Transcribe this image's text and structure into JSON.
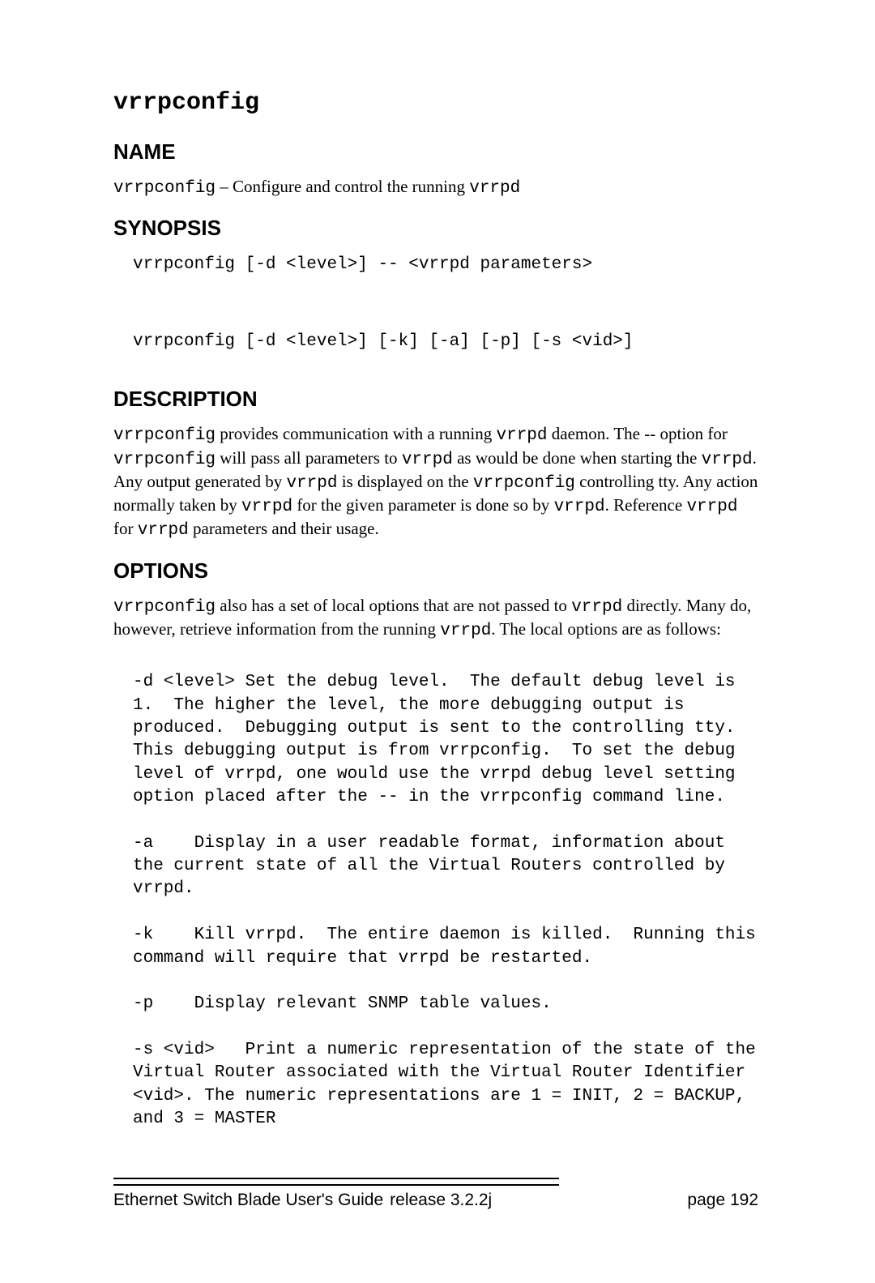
{
  "title_cmd": "vrrpconfig",
  "sections": {
    "name_h": "NAME",
    "name_body_pre1": "vrrpconfig",
    "name_body_mid": " – Configure and control the running ",
    "name_body_pre2": "vrrpd",
    "synopsis_h": "SYNOPSIS",
    "synopsis_block": "vrrpconfig [-d <level>] -- <vrrpd parameters>\n\n\nvrrpconfig [-d <level>] [-k] [-a] [-p] [-s <vid>]",
    "description_h": "DESCRIPTION",
    "desc": {
      "p1a": "vrrpconfig",
      "p1b": " provides communication with a running ",
      "p1c": "vrrpd",
      "p1d": " daemon.  The  -- option for ",
      "p1e": "vrrpconfig",
      "p1f": " will pass all parameters to ",
      "p1g": "vrrpd",
      "p1h": " as would be done when starting the ",
      "p1i": "vrrpd",
      "p1j": ". Any output generated by ",
      "p1k": "vrrpd",
      "p1l": " is displayed on the ",
      "p1m": "vrrpconfig",
      "p1n": " controlling tty. Any action normally taken by ",
      "p1o": "vrrpd",
      "p1p": " for the given parameter is done so by ",
      "p1q": "vrrpd",
      "p1r": ". Reference ",
      "p1s": "vrrpd",
      "p1t": " for ",
      "p1u": "vrrpd",
      "p1v": " parameters and their usage."
    },
    "options_h": "OPTIONS",
    "opt_intro": {
      "a": "vrrpconfig",
      "b": " also has a set of local options that are not passed to ",
      "c": "vrrpd",
      "d": " directly.  Many do, however, retrieve information from the running ",
      "e": "vrrpd",
      "f": ". The local options are as follows:"
    },
    "options_block": "-d <level> Set the debug level.  The default debug level is 1.  The higher the level, the more debugging output is produced.  Debugging output is sent to the controlling tty.  This debugging output is from vrrpconfig.  To set the debug level of vrrpd, one would use the vrrpd debug level setting option placed after the -- in the vrrpconfig command line.\n\n-a    Display in a user readable format, information about the current state of all the Virtual Routers controlled by vrrpd.\n\n-k    Kill vrrpd.  The entire daemon is killed.  Running this command will require that vrrpd be restarted.\n\n-p    Display relevant SNMP table values.\n\n-s <vid>   Print a numeric representation of the state of the Virtual Router associated with the Virtual Router Identifier <vid>. The numeric representations are 1 = INIT, 2 = BACKUP, and 3 = MASTER"
  },
  "footer": {
    "left": "Ethernet Switch Blade User's Guide",
    "mid": "release  3.2.2j",
    "right": "page  192"
  }
}
